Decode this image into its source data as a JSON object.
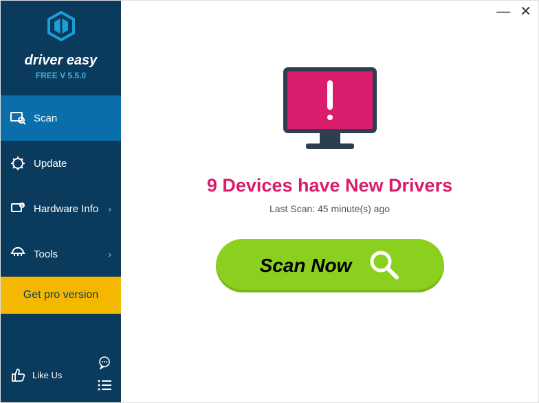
{
  "brand": {
    "name": "driver easy",
    "version_label": "FREE V 5.5.0"
  },
  "sidebar": {
    "items": [
      {
        "label": "Scan",
        "icon": "scan-icon",
        "active": true,
        "has_chevron": false
      },
      {
        "label": "Update",
        "icon": "update-icon",
        "active": false,
        "has_chevron": false
      },
      {
        "label": "Hardware Info",
        "icon": "hardware-icon",
        "active": false,
        "has_chevron": true
      },
      {
        "label": "Tools",
        "icon": "tools-icon",
        "active": false,
        "has_chevron": true
      }
    ],
    "pro_button": "Get pro version",
    "like_label": "Like Us"
  },
  "main": {
    "headline": "9 Devices have New Drivers",
    "subline": "Last Scan: 45 minute(s) ago",
    "scan_button": "Scan Now"
  },
  "colors": {
    "accent_pink": "#d91c6b",
    "action_green": "#8bcf1f",
    "sidebar_dark": "#0a3b5c",
    "sidebar_active": "#0a6eab",
    "gold": "#f5b800"
  }
}
